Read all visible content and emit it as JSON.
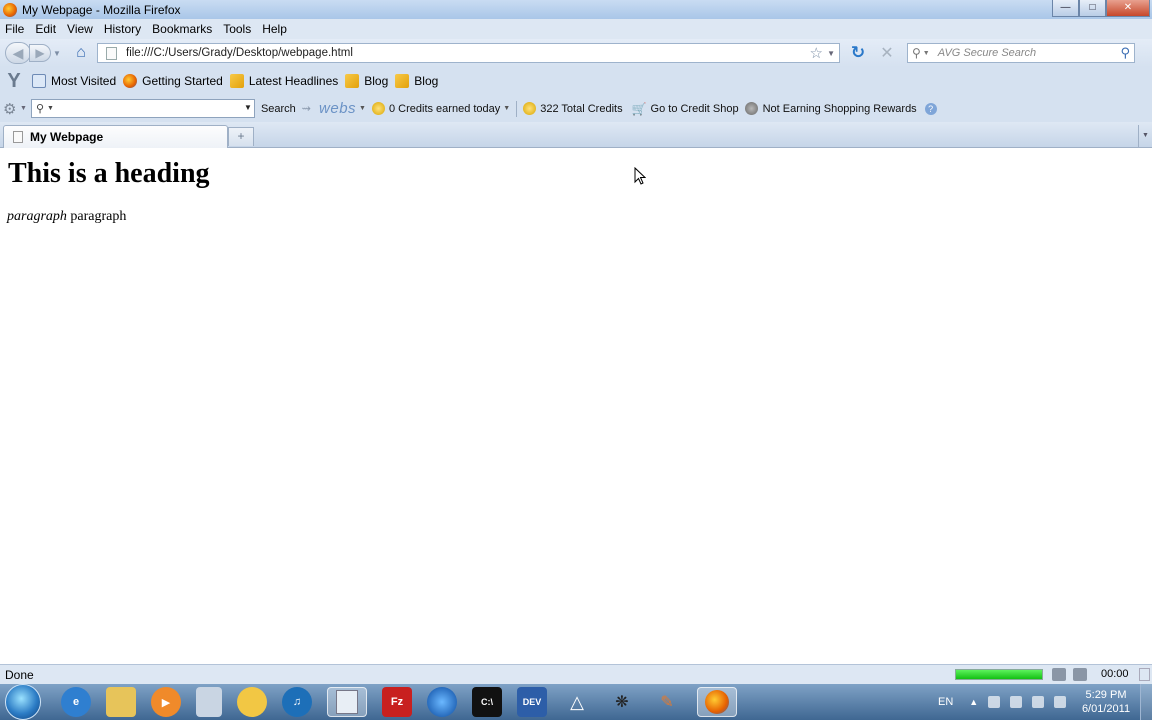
{
  "window": {
    "title": "My Webpage - Mozilla Firefox"
  },
  "menu": [
    "File",
    "Edit",
    "View",
    "History",
    "Bookmarks",
    "Tools",
    "Help"
  ],
  "nav": {
    "url": "file:///C:/Users/Grady/Desktop/webpage.html",
    "search_placeholder": "AVG Secure Search"
  },
  "bookmarks": [
    "Most Visited",
    "Getting Started",
    "Latest Headlines",
    "Blog",
    "Blog"
  ],
  "avg_toolbar": {
    "search_label": "Search",
    "webs": "webs",
    "credits_today": "0 Credits earned today",
    "total_credits": "322 Total Credits",
    "credit_shop": "Go to Credit Shop",
    "rewards": "Not Earning Shopping Rewards"
  },
  "tabs": [
    {
      "label": "My Webpage"
    }
  ],
  "page": {
    "heading": "This is a heading",
    "para_em": "paragraph",
    "para_text": " paragraph"
  },
  "status": {
    "text": "Done",
    "timer": "00:00",
    "progress": 1.0
  },
  "taskbar": {
    "lang": "EN",
    "time": "5:29 PM",
    "date": "6/01/2011",
    "apps": [
      "internet-explorer",
      "windows-explorer",
      "media-player",
      "calculator",
      "paint",
      "itunes",
      "notepad",
      "filezilla",
      "google-earth",
      "cmd",
      "dev-cpp",
      "unity",
      "inkscape",
      "pencil",
      "firefox"
    ]
  }
}
